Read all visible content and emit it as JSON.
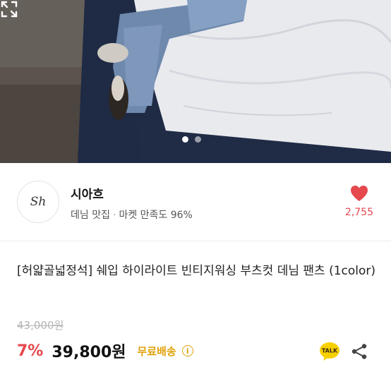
{
  "gallery": {
    "dots": [
      true,
      false
    ],
    "expand_icon": "expand-icon",
    "image_desc_icon": "photo-denim-pants"
  },
  "shop": {
    "logo_text": "Sh",
    "name": "시아흐",
    "category": "데님 맛집",
    "separator": "·",
    "satisfaction": "마켓 만족도 96%",
    "heart_icon": "heart-icon",
    "like_count": "2,755"
  },
  "product": {
    "title": "[허얇골넓정석] 쉐입 하이라이트 빈티지워싱 부츠컷 데님 팬츠 (1color)",
    "original_price": "43,000원",
    "discount": "7%",
    "price": "39,800원",
    "shipping": "무료배송",
    "info_icon": "info-icon",
    "talk_label": "TALK",
    "share_icon": "share-icon"
  },
  "colors": {
    "accent_red": "#e5484d",
    "shipping_yellow": "#e0a20a",
    "talk_yellow": "#f7d000"
  }
}
